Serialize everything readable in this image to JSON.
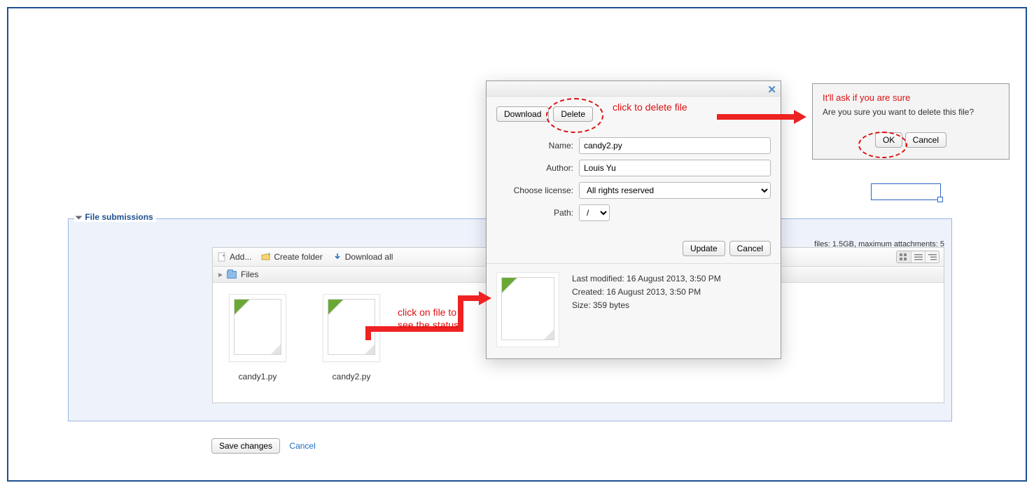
{
  "fieldset": {
    "legend": "File submissions",
    "size_hint": "files: 1.5GB, maximum attachments: 5",
    "toolbar": {
      "add": "Add...",
      "create_folder": "Create folder",
      "download_all": "Download all"
    },
    "path": {
      "root": "Files"
    },
    "files": [
      {
        "name": "candy1.py"
      },
      {
        "name": "candy2.py"
      }
    ]
  },
  "bottom": {
    "save": "Save changes",
    "cancel": "Cancel"
  },
  "dialog": {
    "download": "Download",
    "delete": "Delete",
    "name_label": "Name:",
    "name_value": "candy2.py",
    "author_label": "Author:",
    "author_value": "Louis Yu",
    "license_label": "Choose license:",
    "license_value": "All rights reserved",
    "path_label": "Path:",
    "path_value": "/",
    "update": "Update",
    "cancel": "Cancel",
    "last_modified": "Last modified: 16 August 2013, 3:50 PM",
    "created": "Created: 16 August 2013, 3:50 PM",
    "size": "Size: 359 bytes"
  },
  "confirm": {
    "note": "It'll ask if you are sure",
    "msg": "Are you sure you want to delete this file?",
    "ok": "OK",
    "cancel": "Cancel"
  },
  "annot": {
    "delete_note": "click to delete file",
    "file_note": "click on file to see the status"
  }
}
